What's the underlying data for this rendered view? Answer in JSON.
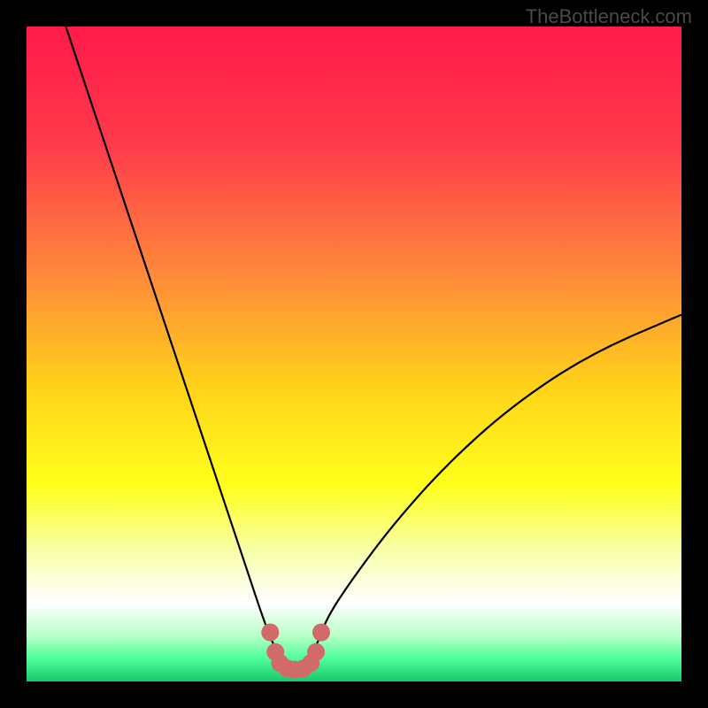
{
  "watermark": "TheBottleneck.com",
  "chart_data": {
    "type": "line",
    "title": "",
    "xlabel": "",
    "ylabel": "",
    "xlim": [
      0,
      100
    ],
    "ylim": [
      0,
      100
    ],
    "series": [
      {
        "name": "bottleneck-curve",
        "x": [
          6,
          10,
          14,
          18,
          22,
          26,
          30,
          34,
          36,
          37.5,
          39,
          41,
          43,
          44.5,
          46,
          50,
          56,
          64,
          74,
          86,
          100
        ],
        "y": [
          100,
          88,
          76,
          64,
          52,
          40,
          28,
          16,
          10,
          6,
          3,
          2,
          3,
          6,
          10,
          16,
          24,
          33,
          42,
          50,
          56
        ]
      }
    ],
    "markers": {
      "name": "highlight-points",
      "color": "#d16b6b",
      "points": [
        {
          "x": 37.2,
          "y": 7.5
        },
        {
          "x": 38.0,
          "y": 4.5
        },
        {
          "x": 38.7,
          "y": 2.8
        },
        {
          "x": 39.8,
          "y": 2.0
        },
        {
          "x": 41.0,
          "y": 1.8
        },
        {
          "x": 42.3,
          "y": 2.0
        },
        {
          "x": 43.4,
          "y": 2.8
        },
        {
          "x": 44.2,
          "y": 4.5
        },
        {
          "x": 45.0,
          "y": 7.5
        }
      ]
    },
    "gradient_stops": [
      {
        "offset": 0.0,
        "color": "#ff1a4a"
      },
      {
        "offset": 0.18,
        "color": "#ff3a4a"
      },
      {
        "offset": 0.38,
        "color": "#ff8a3a"
      },
      {
        "offset": 0.55,
        "color": "#ffd21a"
      },
      {
        "offset": 0.7,
        "color": "#ffff1a"
      },
      {
        "offset": 0.8,
        "color": "#f8ffa8"
      },
      {
        "offset": 0.88,
        "color": "#ffffff"
      },
      {
        "offset": 0.93,
        "color": "#b8ffc8"
      },
      {
        "offset": 0.965,
        "color": "#4dff9a"
      },
      {
        "offset": 1.0,
        "color": "#18c86a"
      }
    ]
  }
}
